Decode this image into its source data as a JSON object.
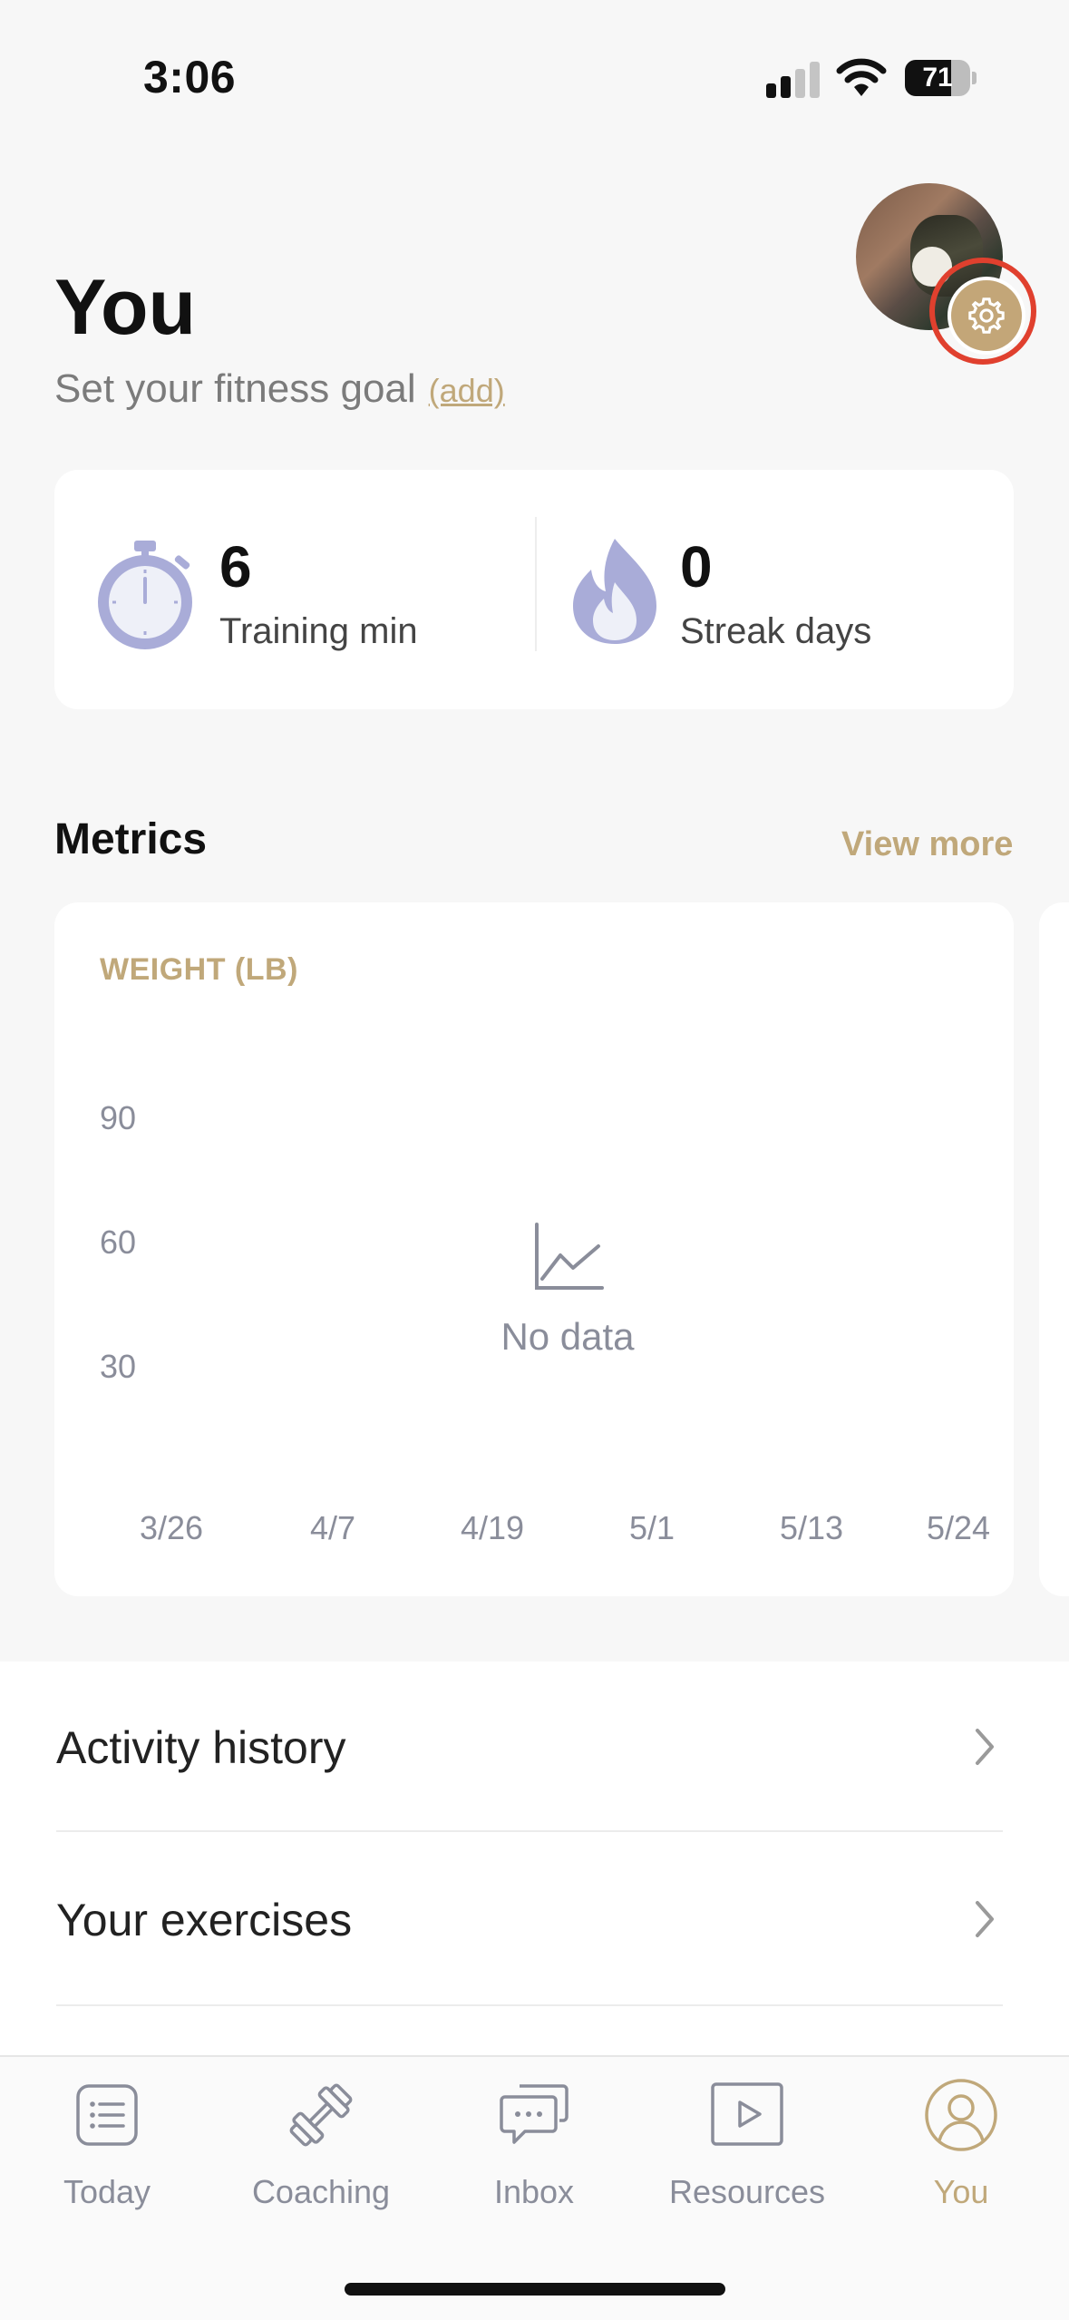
{
  "status_bar": {
    "time": "3:06",
    "battery": "71",
    "battery_level": 0.71
  },
  "header": {
    "title": "You",
    "subtitle": "Set your fitness goal",
    "add_link": "(add)"
  },
  "stats": [
    {
      "value": "6",
      "label": "Training min",
      "icon": "stopwatch-icon"
    },
    {
      "value": "0",
      "label": "Streak days",
      "icon": "flame-icon"
    }
  ],
  "metrics": {
    "title": "Metrics",
    "view_more": "View more",
    "card": {
      "label": "WEIGHT (LB)",
      "no_data": "No data",
      "y_ticks": [
        "90",
        "60",
        "30"
      ],
      "x_ticks": [
        "3/26",
        "4/7",
        "4/19",
        "5/1",
        "5/13",
        "5/24"
      ]
    }
  },
  "list": [
    {
      "label": "Activity history"
    },
    {
      "label": "Your exercises"
    }
  ],
  "tabs": [
    {
      "label": "Today",
      "icon": "list-icon",
      "active": false
    },
    {
      "label": "Coaching",
      "icon": "dumbbell-icon",
      "active": false
    },
    {
      "label": "Inbox",
      "icon": "chat-icon",
      "active": false
    },
    {
      "label": "Resources",
      "icon": "play-icon",
      "active": false
    },
    {
      "label": "You",
      "icon": "profile-icon",
      "active": true
    }
  ],
  "colors": {
    "accent": "#c0a87a",
    "muted": "#8a8d9a",
    "highlight": "#e0402e",
    "icon_lavender": "#a9acd8"
  }
}
